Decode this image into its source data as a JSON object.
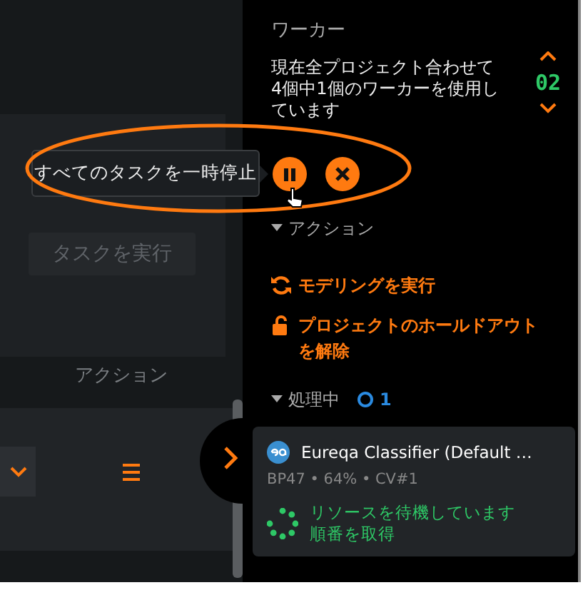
{
  "worker_panel": {
    "title": "ワーカー",
    "message_lines": [
      "現在全プロジェクト合わせて",
      "4個中1個のワーカーを使用し",
      "ています"
    ],
    "worker_count": "02"
  },
  "tooltip": "すべてのタスクを一時停止",
  "left_panel": {
    "run_task_button": {
      "label": "タスクを実行",
      "disabled": true
    },
    "column_header": "アクション"
  },
  "actions_section": {
    "title": "アクション",
    "expanded": true,
    "links": [
      {
        "label": "モデリングを実行",
        "kind": "refresh"
      },
      {
        "label": "プロジェクトのホールドアウトを解除",
        "kind": "unlock"
      }
    ]
  },
  "processing": {
    "title": "処理中",
    "expanded": true,
    "count": "1",
    "jobs": [
      {
        "name": "Eureqa Classifier (Default …",
        "meta": "BP47 • 64% • CV#1",
        "status_lines": [
          "リソースを待機しています",
          "順番を取得"
        ]
      }
    ]
  }
}
